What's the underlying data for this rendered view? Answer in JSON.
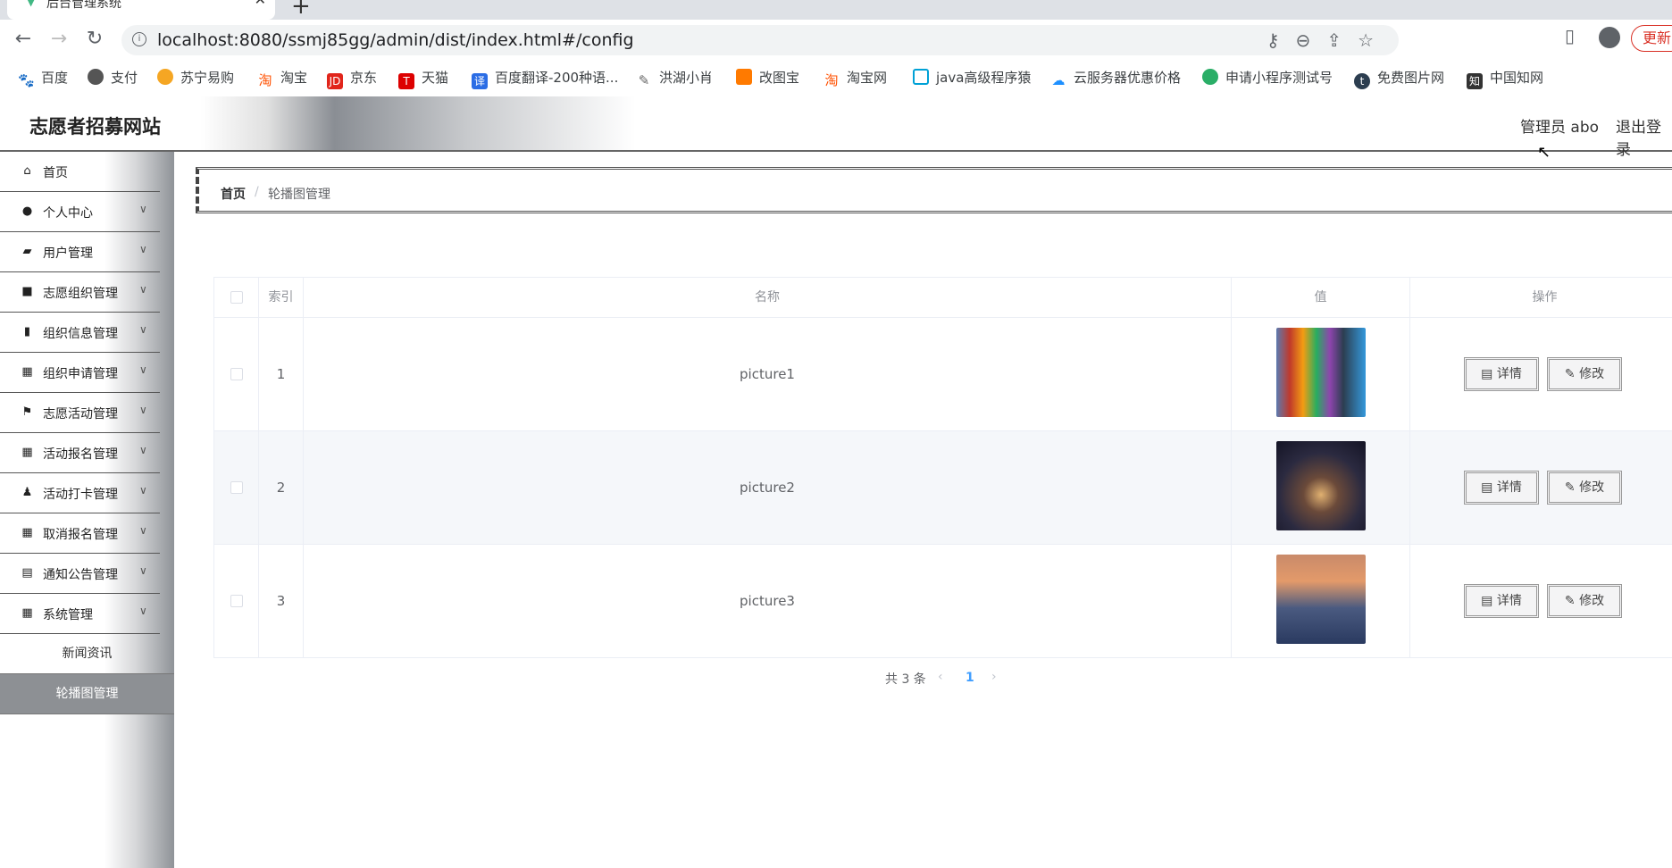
{
  "browser": {
    "tab_title": "后台管理系统",
    "url": "localhost:8080/ssmj85gg/admin/dist/index.html#/config",
    "update_label": "更新",
    "bookmarks": [
      "百度",
      "支付",
      "苏宁易购",
      "淘宝",
      "京东",
      "天猫",
      "百度翻译-200种语...",
      "洪湖小肖",
      "改图宝",
      "淘宝网",
      "java高级程序猿",
      "云服务器优惠价格",
      "申请小程序测试号",
      "免费图片网",
      "中国知网"
    ]
  },
  "header": {
    "title": "志愿者招募网站",
    "user": "管理员 abo",
    "logout": "退出登录"
  },
  "sidebar": {
    "items": [
      {
        "label": "首页",
        "icon": "home-icon"
      },
      {
        "label": "个人中心",
        "icon": "user-icon"
      },
      {
        "label": "用户管理",
        "icon": "thumb-icon"
      },
      {
        "label": "志愿组织管理",
        "icon": "video-icon"
      },
      {
        "label": "组织信息管理",
        "icon": "chart-icon"
      },
      {
        "label": "组织申请管理",
        "icon": "grid-icon"
      },
      {
        "label": "志愿活动管理",
        "icon": "flag-icon"
      },
      {
        "label": "活动报名管理",
        "icon": "grid-icon"
      },
      {
        "label": "活动打卡管理",
        "icon": "person-icon"
      },
      {
        "label": "取消报名管理",
        "icon": "grid-icon"
      },
      {
        "label": "通知公告管理",
        "icon": "clipboard-icon"
      },
      {
        "label": "系统管理",
        "icon": "grid-icon"
      }
    ],
    "sub_items": [
      {
        "label": "新闻资讯"
      },
      {
        "label": "轮播图管理"
      }
    ]
  },
  "breadcrumb": {
    "home": "首页",
    "separator": "/",
    "current": "轮播图管理"
  },
  "table": {
    "headers": {
      "index": "索引",
      "name": "名称",
      "value": "值",
      "action": "操作"
    },
    "rows": [
      {
        "index": "1",
        "name": "picture1"
      },
      {
        "index": "2",
        "name": "picture2"
      },
      {
        "index": "3",
        "name": "picture3"
      }
    ],
    "detail_label": "详情",
    "edit_label": "修改"
  },
  "pagination": {
    "total": "共 3 条",
    "current_page": "1"
  }
}
